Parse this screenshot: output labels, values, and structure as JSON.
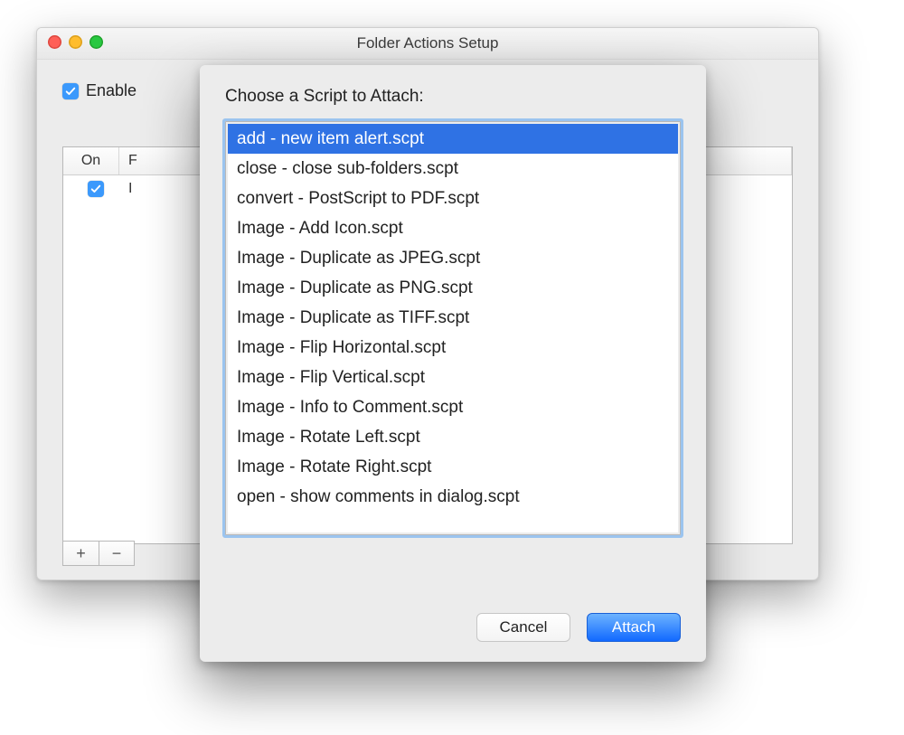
{
  "window": {
    "title": "Folder Actions Setup"
  },
  "main": {
    "enable_label": "Enable",
    "enable_checked": true,
    "table": {
      "columns": {
        "on": "On",
        "folder": "F"
      },
      "rows": [
        {
          "on": true,
          "folder": "I"
        }
      ]
    },
    "add_label": "+",
    "remove_label": "−"
  },
  "sheet": {
    "title": "Choose a Script to Attach:",
    "scripts": [
      {
        "label": "add - new item alert.scpt",
        "selected": true
      },
      {
        "label": "close - close sub-folders.scpt",
        "selected": false
      },
      {
        "label": "convert - PostScript to PDF.scpt",
        "selected": false
      },
      {
        "label": "Image - Add Icon.scpt",
        "selected": false
      },
      {
        "label": "Image - Duplicate as JPEG.scpt",
        "selected": false
      },
      {
        "label": "Image - Duplicate as PNG.scpt",
        "selected": false
      },
      {
        "label": "Image - Duplicate as TIFF.scpt",
        "selected": false
      },
      {
        "label": "Image - Flip Horizontal.scpt",
        "selected": false
      },
      {
        "label": "Image - Flip Vertical.scpt",
        "selected": false
      },
      {
        "label": "Image - Info to Comment.scpt",
        "selected": false
      },
      {
        "label": "Image - Rotate Left.scpt",
        "selected": false
      },
      {
        "label": "Image - Rotate Right.scpt",
        "selected": false
      },
      {
        "label": "open - show comments in dialog.scpt",
        "selected": false
      }
    ],
    "cancel_label": "Cancel",
    "attach_label": "Attach"
  }
}
